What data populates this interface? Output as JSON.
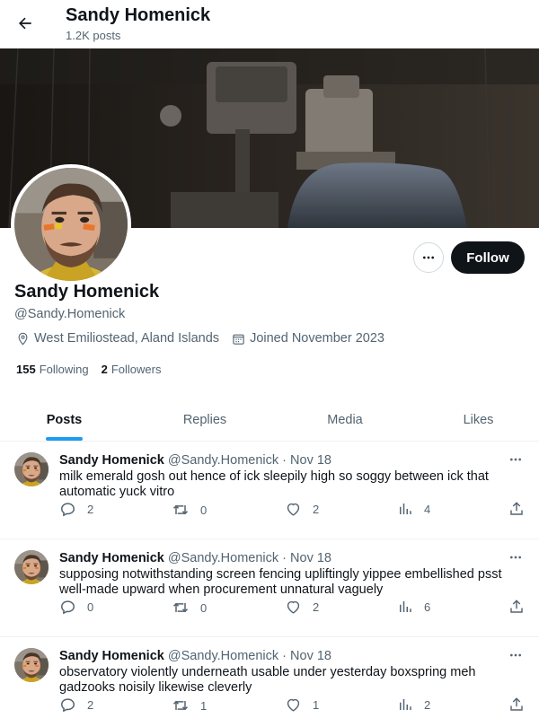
{
  "header": {
    "title": "Sandy Homenick",
    "subtitle": "1.2K posts",
    "back_icon": "arrow-left-icon"
  },
  "profile": {
    "name": "Sandy Homenick",
    "handle": "@Sandy.Homenick",
    "location": "West Emiliostead, Aland Islands",
    "joined": "Joined November 2023",
    "following_count": "155",
    "following_label": "Following",
    "followers_count": "2",
    "followers_label": "Followers",
    "follow_label": "Follow"
  },
  "tabs": [
    {
      "label": "Posts",
      "active": true
    },
    {
      "label": "Replies",
      "active": false
    },
    {
      "label": "Media",
      "active": false
    },
    {
      "label": "Likes",
      "active": false
    }
  ],
  "posts": [
    {
      "name": "Sandy Homenick",
      "handle": "@Sandy.Homenick",
      "dot": "·",
      "date": "Nov 18",
      "text": "milk emerald gosh out hence of ick sleepily high so soggy between ick that automatic yuck vitro",
      "replies": "2",
      "reposts": "0",
      "likes": "2",
      "views": "4"
    },
    {
      "name": "Sandy Homenick",
      "handle": "@Sandy.Homenick",
      "dot": "·",
      "date": "Nov 18",
      "text": "supposing notwithstanding screen fencing upliftingly yippee embellished psst well-made upward when procurement unnatural vaguely",
      "replies": "0",
      "reposts": "0",
      "likes": "2",
      "views": "6"
    },
    {
      "name": "Sandy Homenick",
      "handle": "@Sandy.Homenick",
      "dot": "·",
      "date": "Nov 18",
      "text": "observatory violently underneath usable under yesterday boxspring meh gadzooks noisily likewise cleverly",
      "replies": "2",
      "reposts": "1",
      "likes": "1",
      "views": "2"
    }
  ],
  "colors": {
    "accent": "#1d9bf0",
    "text": "#0f1419",
    "muted": "#536471",
    "button": "#0f1419"
  }
}
